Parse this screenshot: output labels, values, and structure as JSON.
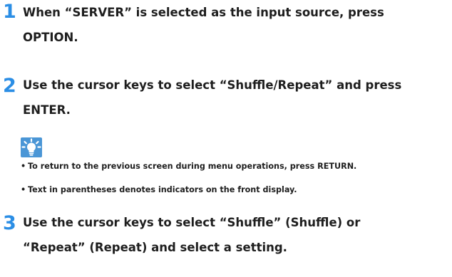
{
  "colors": {
    "step_number": "#2b8ee5",
    "text": "#1e1e1e",
    "hint_icon": "#4a96d6"
  },
  "steps": [
    {
      "number": "1",
      "lines": [
        "When “SERVER” is selected as the input source, press",
        "OPTION."
      ]
    },
    {
      "number": "2",
      "lines": [
        "Use the cursor keys to select “Shuffle/Repeat” and press",
        "ENTER."
      ]
    },
    {
      "number": "3",
      "lines": [
        "Use the cursor keys to select “Shuffle” (Shuffle) or",
        "“Repeat” (Repeat) and select a setting."
      ]
    }
  ],
  "hint": {
    "icon": "lightbulb-hint-icon",
    "notes": [
      "To return to the previous screen during menu operations, press RETURN.",
      "Text in parentheses denotes indicators on the front display."
    ]
  }
}
